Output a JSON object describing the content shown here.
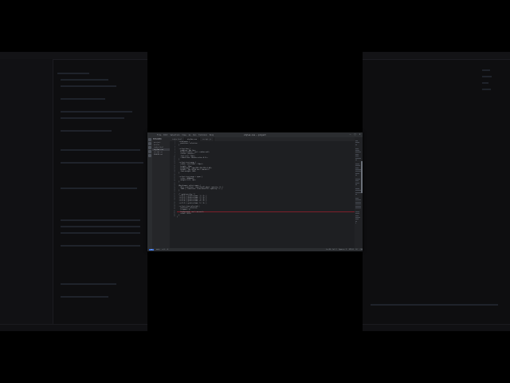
{
  "window": {
    "title": "styles.css — project",
    "menu": [
      "File",
      "Edit",
      "Selection",
      "View",
      "Go",
      "Run",
      "Terminal",
      "Help"
    ]
  },
  "sidebar": {
    "header": "EXPLORER",
    "items": [
      {
        "label": "project"
      },
      {
        "label": "assets"
      },
      {
        "label": "index.html"
      },
      {
        "label": "styles.css"
      },
      {
        "label": "script.js"
      },
      {
        "label": "README.md"
      }
    ]
  },
  "tabs": [
    {
      "label": "index.html"
    },
    {
      "label": "styles.css"
    },
    {
      "label": "script.js"
    }
  ],
  "code_lines": [
    "  .card-menu {",
    "    position: relative;",
    "  }",
    "",
    "  .select-box {",
    "    padding: 4px 6px;",
    "    border-radius: var(--radius-md);",
    "    cursor: pointer;",
    "    font-size: 14px;",
    "    transition: border-color 0.2s;",
    "  }",
    "",
    "  .select-text-wrap {",
    "    width: calc(100% - 24px);",
    "    height: 32px;",
    "    background: rgba(255,255,255,0.05);",
    "    border: 1px solid var(--border);",
    "    font-weight: 600;",
    "  }",
    "",
    "  .select-text-wrap > span {",
    "    color: #d8dae0;",
    "    margin-left: 4px;",
    "  }",
    "",
    "  @keyframes select-open {",
    "    0% { transform: translateY(-4px); opacity: 0; }",
    "    100% { transform: translateY(0); opacity: 1; }",
    "  }",
    "",
    "  /* grid-overlay */",
    "  .cell-1 { grid-column: 1 / 2; }",
    "  .cell-2 { grid-column: 2 / 3; }",
    "  .cell-3 { grid-column: 3 / 4; }",
    "  .cell-4 { grid-column: 4 / 5; }",
    "  .cell-5 { grid-column: 5 / 6; }",
    "",
    "  .select-item.selected {",
    "    position: relative;",
    "    z-index: 2;",
    "    background: var(--accent);",
    "    color: #fff;",
    "  }",
    "}"
  ],
  "statusbar": {
    "remote": "><",
    "branch": "main",
    "problems": "⊗ 0 ⚠ 0",
    "position": "Ln 43, Col 2",
    "spaces": "Spaces: 2",
    "encoding": "UTF-8",
    "eol": "LF",
    "language": "CSS"
  },
  "colors": {
    "editor_bg": "#1e1f22",
    "chrome_bg": "#2b2d30",
    "sidebar_bg": "#252629",
    "accent": "#3a6fd8",
    "error_line": "#7d1f2a"
  }
}
